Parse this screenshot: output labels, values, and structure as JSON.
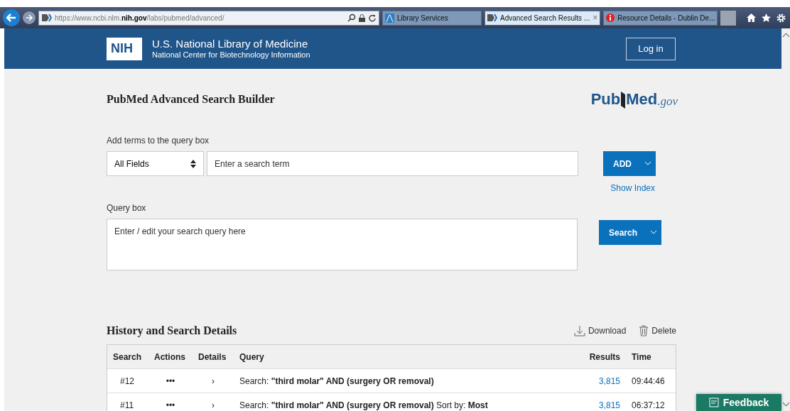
{
  "browser": {
    "address": "https://www.ncbi.nlm.**nih.gov**/labs/pubmed/advanced/",
    "tabs": [
      {
        "label": "Library Services",
        "selected": false,
        "kind": "library"
      },
      {
        "label": "Advanced Search Results ...",
        "selected": true,
        "kind": "pubmed",
        "close": "×"
      },
      {
        "label": "Resource Details - Dublin De...",
        "selected": false,
        "kind": "info"
      }
    ]
  },
  "header": {
    "logo": "NIH",
    "title": "U.S. National Library of Medicine",
    "subtitle": "National Center for Biotechnology Information",
    "login": "Log in"
  },
  "builder": {
    "title": "PubMed Advanced Search Builder",
    "logo_main_1": "Pub",
    "logo_main_2": "Med",
    "logo_suffix": ".gov",
    "add_label": "Add terms to the query box",
    "field_select": "All Fields",
    "term_placeholder": "Enter a search term",
    "add_button": "ADD",
    "show_index": "Show Index",
    "query_label": "Query box",
    "query_placeholder": "Enter / edit your search query here",
    "search_button": "Search"
  },
  "history": {
    "title": "History and Search Details",
    "download": "Download",
    "delete": "Delete",
    "columns": [
      "Search",
      "Actions",
      "Details",
      "Query",
      "Results",
      "Time"
    ],
    "rows": [
      {
        "search": "#12",
        "actions": "•••",
        "details": "›",
        "query": "Search: **\"third molar\" AND (surgery OR removal)**",
        "results": "3,815",
        "time": "09:44:46"
      },
      {
        "search": "#11",
        "actions": "•••",
        "details": "›",
        "query": "Search: **\"third molar\" AND (surgery OR removal)** Sort by: **Most**",
        "results": "3,815",
        "time": "06:37:12"
      }
    ]
  },
  "feedback": "Feedback"
}
